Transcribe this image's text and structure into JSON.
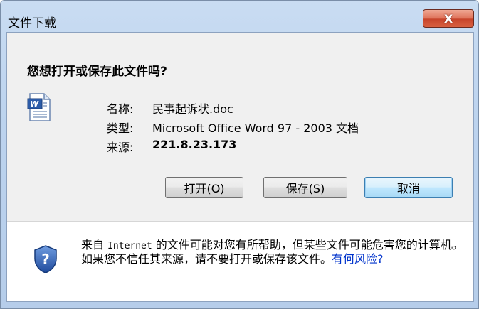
{
  "window": {
    "title": "文件下载",
    "close_label": "X"
  },
  "dialog": {
    "question": "您想打开或保存此文件吗?",
    "file": {
      "name_label": "名称:",
      "name_value": "民事起诉状.doc",
      "type_label": "类型:",
      "type_value": "Microsoft Office Word 97 - 2003 文档",
      "source_label": "来源:",
      "source_value": "221.8.23.173"
    },
    "buttons": {
      "open": "打开(O)",
      "save": "保存(S)",
      "cancel": "取消"
    },
    "warning": {
      "prefix": "来自 ",
      "internet": "Internet",
      "body": " 的文件可能对您有所帮助，但某些文件可能危害您的计算机。如果您不信任其来源，请不要打开或保存该文件。",
      "link": "有何风险?"
    }
  },
  "icons": {
    "document": "word-document-icon",
    "security": "shield-question-icon"
  },
  "colors": {
    "close_button": "#c8452c",
    "link": "#0033cc",
    "shield": "#2a5bb0"
  }
}
